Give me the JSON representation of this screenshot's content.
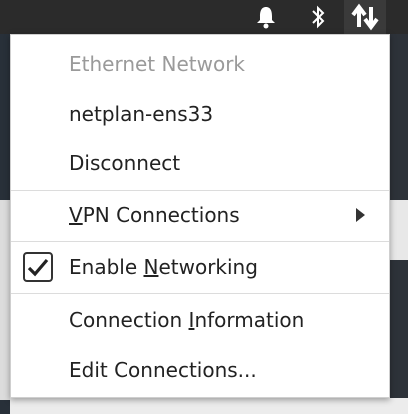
{
  "panel": {
    "icons": [
      "bell-icon",
      "bluetooth-icon",
      "network-arrows-icon"
    ]
  },
  "menu": {
    "header": "Ethernet Network",
    "connection_name": "netplan-ens33",
    "disconnect": "Disconnect",
    "vpn": {
      "pre": "",
      "mnemonic": "V",
      "post": "PN Connections"
    },
    "enable_networking": {
      "pre": "Enable ",
      "mnemonic": "N",
      "post": "etworking",
      "checked": true
    },
    "connection_info": {
      "pre": "Connection ",
      "mnemonic": "I",
      "post": "nformation"
    },
    "edit_connections": "Edit Connections..."
  },
  "colors": {
    "panel": "#2b2b2b",
    "menu_bg": "#ffffff",
    "text": "#222222",
    "disabled_text": "#9a9a9a"
  }
}
